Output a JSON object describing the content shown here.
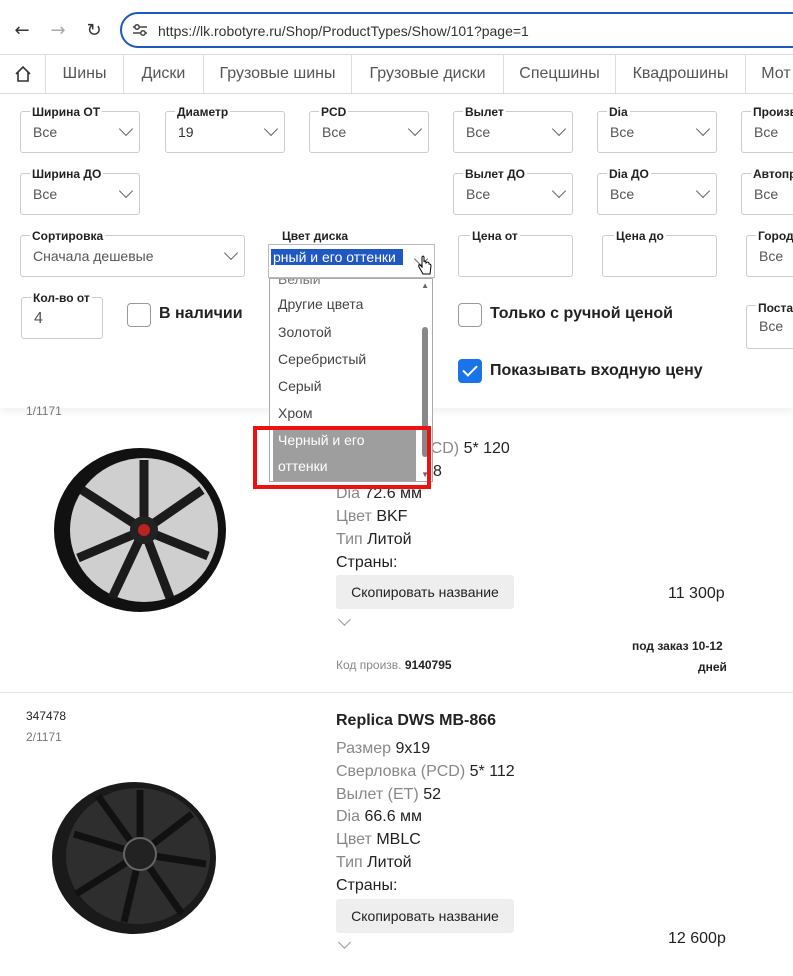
{
  "browser": {
    "url": "https://lk.robotyre.ru/Shop/ProductTypes/Show/101?page=1",
    "back_icon": "←",
    "forward_icon": "→",
    "reload_icon": "↻"
  },
  "tabs": [
    "Шины",
    "Диски",
    "Грузовые шины",
    "Грузовые диски",
    "Спецшины",
    "Квадрошины",
    "Мот"
  ],
  "filters": {
    "width_from": {
      "label": "Ширина ОТ",
      "value": "Все"
    },
    "diameter": {
      "label": "Диаметр",
      "value": "19"
    },
    "pcd": {
      "label": "PCD",
      "value": "Все"
    },
    "offset": {
      "label": "Вылет",
      "value": "Все"
    },
    "dia": {
      "label": "Dia",
      "value": "Все"
    },
    "manufacturer": {
      "label": "Произв",
      "value": "Все"
    },
    "width_to": {
      "label": "Ширина ДО",
      "value": "Все"
    },
    "offset_to": {
      "label": "Вылет ДО",
      "value": "Все"
    },
    "dia_to": {
      "label": "Dia ДО",
      "value": "Все"
    },
    "auto": {
      "label": "Автопр",
      "value": "Все"
    },
    "sort": {
      "label": "Сортировка",
      "value": "Сначала дешевые"
    },
    "disk_color": {
      "label": "Цвет диска",
      "value": "рный и его оттенки"
    },
    "price_from": {
      "label": "Цена от",
      "value": ""
    },
    "price_to": {
      "label": "Цена до",
      "value": ""
    },
    "city": {
      "label": "Город",
      "value": "Все"
    },
    "qty_from": {
      "label": "Кол-во от",
      "value": "4"
    },
    "supplier": {
      "label": "Поста",
      "value": "Все"
    },
    "in_stock": {
      "label": "В наличии",
      "checked": false
    },
    "manual_price": {
      "label": "Только с ручной ценой",
      "checked": false
    },
    "show_input_price": {
      "label": "Показывать входную цену",
      "checked": true
    }
  },
  "color_dropdown": {
    "partial_top": "Белый",
    "items": [
      "Другие цвета",
      "Золотой",
      "Серебристый",
      "Серый",
      "Хром"
    ],
    "selected_line1": "Черный и его",
    "selected_line2": "оттенки"
  },
  "products": [
    {
      "index": "1/1171",
      "pcd_partial_label": "PCD)",
      "pcd_value": "5* 120",
      "partial_value": "8",
      "dia_label": "Dia",
      "dia_value": "72.6 мм",
      "color_label": "Цвет",
      "color_value": "BKF",
      "type_label": "Тип",
      "type_value": "Литой",
      "countries_label": "Страны:",
      "copy_label": "Скопировать название",
      "price": "11 300р",
      "delivery_line1": "под заказ 10-12",
      "delivery_line2": "дней",
      "code_label": "Код произв.",
      "code_value": "9140795"
    },
    {
      "id": "347478",
      "index": "2/1171",
      "title": "Replica DWS MB-866",
      "size_label": "Размер",
      "size_value": "9x19",
      "pcd_label": "Сверловка (PCD)",
      "pcd_value": "5* 112",
      "offset_label": "Вылет (ET)",
      "offset_value": "52",
      "dia_label": "Dia",
      "dia_value": "66.6 мм",
      "color_label": "Цвет",
      "color_value": "MBLC",
      "type_label": "Тип",
      "type_value": "Литой",
      "countries_label": "Страны:",
      "copy_label": "Скопировать название",
      "price": "12 600р"
    }
  ],
  "colors": {
    "accent": "#1a73e8",
    "url_border": "#1f57c3",
    "highlight": "#ee1111"
  }
}
